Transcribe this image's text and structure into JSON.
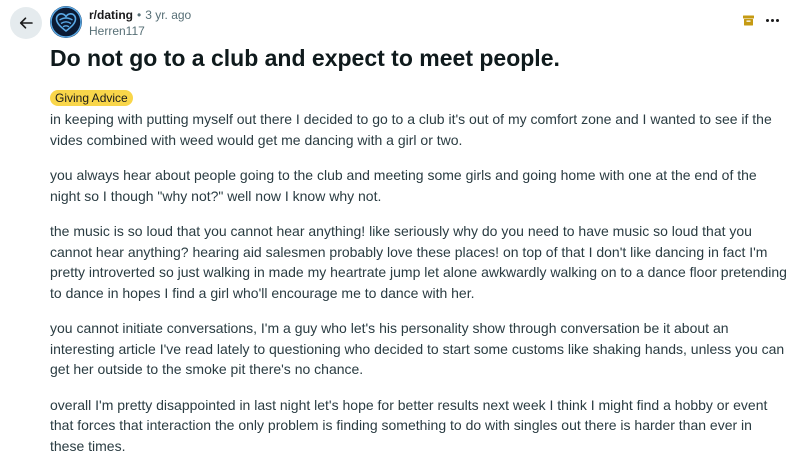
{
  "post": {
    "subreddit": "r/dating",
    "separator": "•",
    "age": "3 yr. ago",
    "author": "Herren117",
    "title": "Do not go to a club and expect to meet people.",
    "flair": "Giving Advice",
    "paragraphs": [
      "in keeping with putting myself out there I decided to go to a club it's out of my comfort zone and I wanted to see if the vides combined with weed would get me dancing with a girl or two.",
      "you always hear about people going to the club and meeting some girls and going home with one at the end of the night so I though \"why not?\" well now I know why not.",
      "the music is so loud that you cannot hear anything! like seriously why do you need to have music so loud that you cannot hear anything? hearing aid salesmen probably love these places! on top of that I don't like dancing in fact I'm pretty introverted so just walking in made my heartrate jump let alone awkwardly walking on to a dance floor pretending to dance in hopes I find a girl who'll encourage me to dance with her.",
      "you cannot initiate conversations, I'm a guy who let's his personality show through conversation be it about an interesting article I've read lately to questioning who decided to start some customs like shaking hands, unless you can get her outside to the smoke pit there's no chance.",
      "overall I'm pretty disappointed in last night let's hope for better results next week I think I might find a hobby or event that forces that interaction the only problem is finding something to do with singles out there is harder than ever in these times."
    ]
  },
  "icons": {
    "back": "arrow-left-icon",
    "avatar": "subreddit-heart-icon",
    "archived": "archive-icon",
    "more": "more-options-icon"
  },
  "colors": {
    "flair_bg": "#f9d64a",
    "archive_icon": "#c59a12",
    "back_button_bg": "#e5ebee",
    "avatar_bg": "#0b1a33",
    "avatar_fg": "#5aa9e6",
    "meta_text": "#576f76",
    "body_text": "#2a3c42"
  }
}
